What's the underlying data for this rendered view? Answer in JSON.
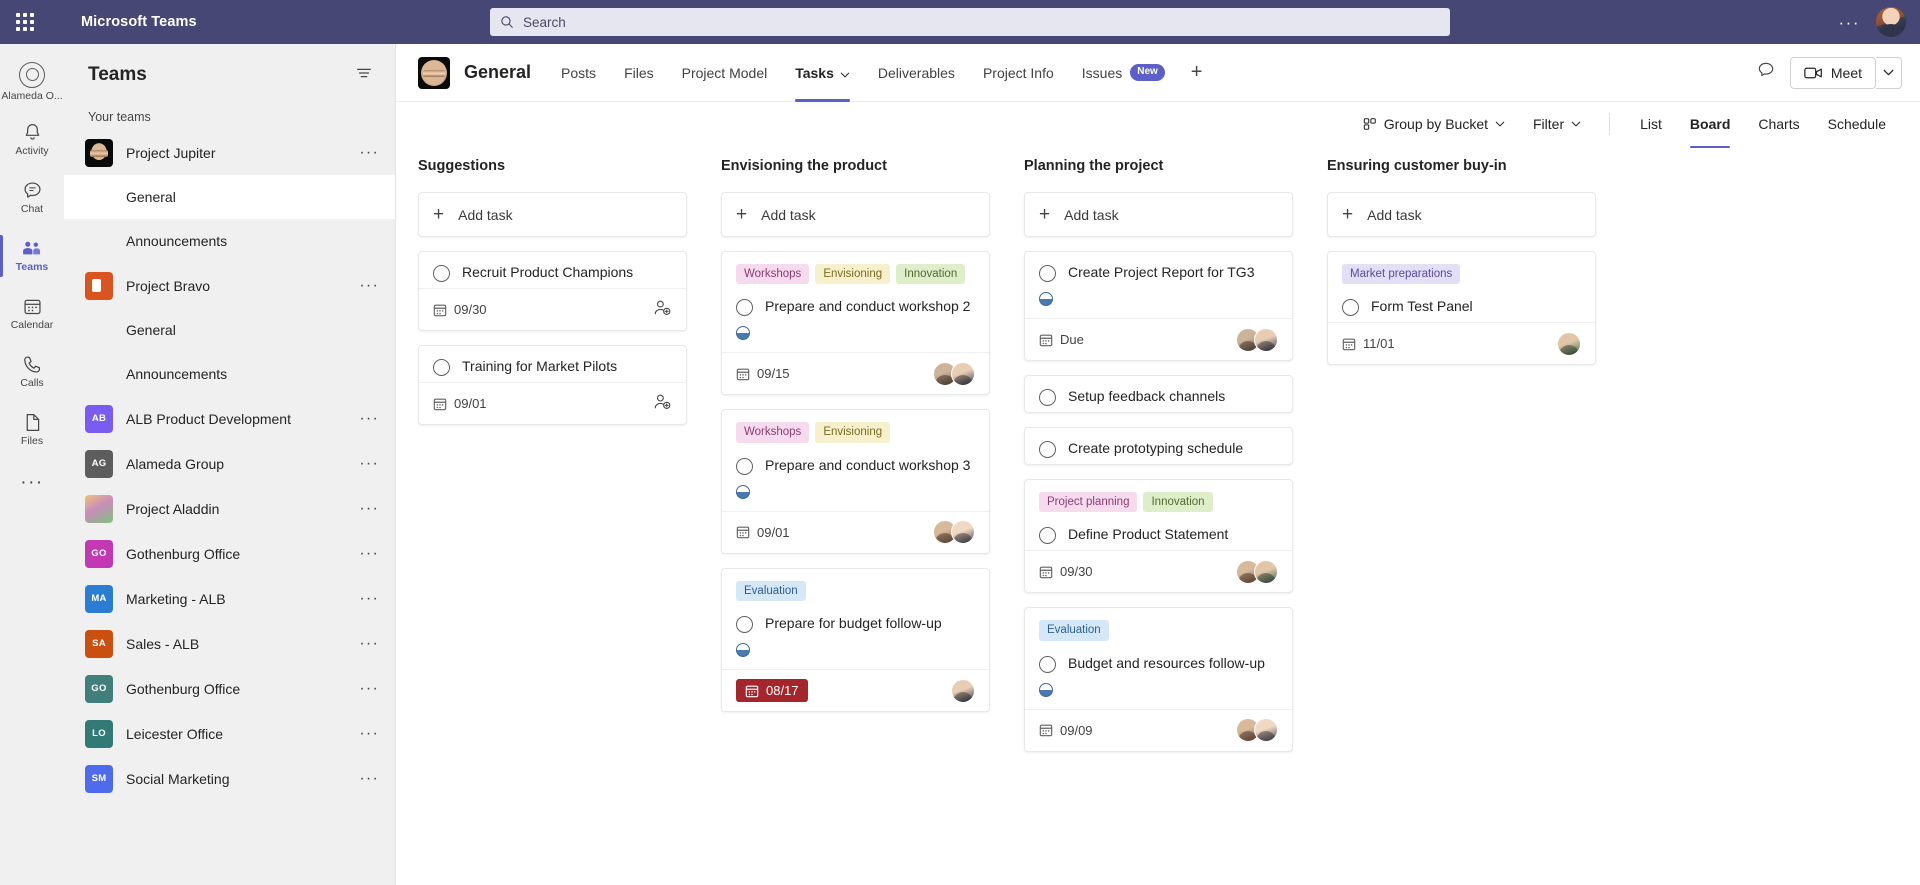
{
  "topbar": {
    "waffle_icon": "app-launcher-icon",
    "app_title": "Microsoft Teams",
    "search_placeholder": "Search",
    "search_icon": "search-icon",
    "more_label": "···",
    "avatar_name": "user-avatar",
    "bg_color": "#464775"
  },
  "rail": {
    "items": [
      {
        "label": "Alameda O...",
        "icon": "org-logo-icon",
        "active": false
      },
      {
        "label": "Activity",
        "icon": "bell-icon",
        "active": false
      },
      {
        "label": "Chat",
        "icon": "chat-bubble-icon",
        "active": false
      },
      {
        "label": "Teams",
        "icon": "teams-people-icon",
        "active": true
      },
      {
        "label": "Calendar",
        "icon": "calendar-icon",
        "active": false
      },
      {
        "label": "Calls",
        "icon": "phone-icon",
        "active": false
      },
      {
        "label": "Files",
        "icon": "file-icon",
        "active": false
      }
    ],
    "more_label": "···",
    "accent_color": "#5b5fc7"
  },
  "sidebar": {
    "title": "Teams",
    "filter_icon": "filter-list-icon",
    "section_label": "Your teams",
    "teams": [
      {
        "name": "Project Jupiter",
        "avatar_kind": "jupiter",
        "initials": "",
        "color": "#0a0a0a",
        "channels": [
          {
            "name": "General",
            "selected": true
          },
          {
            "name": "Announcements",
            "selected": false
          }
        ]
      },
      {
        "name": "Project Bravo",
        "avatar_kind": "bravo",
        "initials": "",
        "color": "#d9541e",
        "channels": [
          {
            "name": "General",
            "selected": false
          },
          {
            "name": "Announcements",
            "selected": false
          }
        ]
      },
      {
        "name": "ALB Product Development",
        "avatar_kind": "initials",
        "initials": "AB",
        "color": "#7b5cf0",
        "channels": []
      },
      {
        "name": "Alameda Group",
        "avatar_kind": "initials",
        "initials": "AG",
        "color": "#5d5d5d",
        "channels": []
      },
      {
        "name": "Project Aladdin",
        "avatar_kind": "aladdin",
        "initials": "",
        "color": "#c78dbb",
        "channels": []
      },
      {
        "name": "Gothenburg Office",
        "avatar_kind": "initials",
        "initials": "GO",
        "color": "#c239b3",
        "channels": []
      },
      {
        "name": "Marketing - ALB",
        "avatar_kind": "initials",
        "initials": "MA",
        "color": "#2b7cd3",
        "channels": []
      },
      {
        "name": "Sales - ALB",
        "avatar_kind": "initials",
        "initials": "SA",
        "color": "#ca5010",
        "channels": []
      },
      {
        "name": "Gothenburg Office",
        "avatar_kind": "initials",
        "initials": "GO",
        "color": "#407f7c",
        "channels": []
      },
      {
        "name": "Leicester Office",
        "avatar_kind": "initials",
        "initials": "LO",
        "color": "#327a76",
        "channels": []
      },
      {
        "name": "Social Marketing",
        "avatar_kind": "initials",
        "initials": "SM",
        "color": "#4f6bed",
        "channels": []
      }
    ],
    "overflow_label": "···"
  },
  "channel": {
    "avatar_name": "jupiter-channel-avatar",
    "title": "General",
    "tabs": [
      {
        "label": "Posts",
        "active": false,
        "has_caret": false,
        "badge": ""
      },
      {
        "label": "Files",
        "active": false,
        "has_caret": false,
        "badge": ""
      },
      {
        "label": "Project Model",
        "active": false,
        "has_caret": false,
        "badge": ""
      },
      {
        "label": "Tasks",
        "active": true,
        "has_caret": true,
        "badge": ""
      },
      {
        "label": "Deliverables",
        "active": false,
        "has_caret": false,
        "badge": ""
      },
      {
        "label": "Project Info",
        "active": false,
        "has_caret": false,
        "badge": ""
      },
      {
        "label": "Issues",
        "active": false,
        "has_caret": false,
        "badge": "New"
      }
    ],
    "add_tab_label": "+",
    "chat_icon": "chat-icon",
    "meet_label": "Meet",
    "meet_icon": "video-camera-icon",
    "meet_caret_icon": "chevron-down-icon"
  },
  "toolbar": {
    "group_by_label": "Group by Bucket",
    "group_by_icon": "group-icon",
    "filter_label": "Filter",
    "filter_icon": "filter-icon",
    "views": [
      {
        "label": "List",
        "active": false
      },
      {
        "label": "Board",
        "active": true
      },
      {
        "label": "Charts",
        "active": false
      },
      {
        "label": "Schedule",
        "active": false
      }
    ]
  },
  "board": {
    "add_task_label": "Add task",
    "buckets": [
      {
        "title": "Suggestions",
        "tasks": [
          {
            "labels": [],
            "title": "Recruit Product Champions",
            "progress": false,
            "date": "09/30",
            "overdue": false,
            "assign_icon": "assign-person-icon",
            "avatars": []
          },
          {
            "labels": [],
            "title": "Training for Market Pilots",
            "progress": false,
            "date": "09/01",
            "overdue": false,
            "assign_icon": "assign-person-icon",
            "avatars": []
          }
        ]
      },
      {
        "title": "Envisioning the product",
        "tasks": [
          {
            "labels": [
              {
                "text": "Workshops",
                "color": "pink"
              },
              {
                "text": "Envisioning",
                "color": "yellow"
              },
              {
                "text": "Innovation",
                "color": "green"
              }
            ],
            "title": "Prepare and conduct workshop 2",
            "progress": true,
            "date": "09/15",
            "overdue": false,
            "assign_icon": "",
            "avatars": [
              "a1",
              "a2"
            ]
          },
          {
            "labels": [
              {
                "text": "Workshops",
                "color": "pink"
              },
              {
                "text": "Envisioning",
                "color": "yellow"
              }
            ],
            "title": "Prepare and conduct workshop 3",
            "progress": true,
            "date": "09/01",
            "overdue": false,
            "assign_icon": "",
            "avatars": [
              "a3",
              "a4"
            ]
          },
          {
            "labels": [
              {
                "text": "Evaluation",
                "color": "blue"
              }
            ],
            "title": "Prepare for budget follow-up",
            "progress": true,
            "date": "08/17",
            "overdue": true,
            "assign_icon": "",
            "avatars": [
              "a2"
            ]
          }
        ]
      },
      {
        "title": "Planning the project",
        "tasks": [
          {
            "labels": [],
            "title": "Create Project Report for TG3",
            "progress": true,
            "date": "Due",
            "overdue": false,
            "assign_icon": "",
            "avatars": [
              "a1",
              "a2"
            ]
          },
          {
            "labels": [],
            "title": "Setup feedback channels",
            "progress": false,
            "date": "",
            "overdue": false,
            "assign_icon": "",
            "avatars": []
          },
          {
            "labels": [],
            "title": "Create prototyping schedule",
            "progress": false,
            "date": "",
            "overdue": false,
            "assign_icon": "",
            "avatars": []
          },
          {
            "labels": [
              {
                "text": "Project planning",
                "color": "pink"
              },
              {
                "text": "Innovation",
                "color": "green"
              }
            ],
            "title": "Define Product Statement",
            "progress": false,
            "date": "09/30",
            "overdue": false,
            "assign_icon": "",
            "avatars": [
              "a3",
              "a5"
            ]
          },
          {
            "labels": [
              {
                "text": "Evaluation",
                "color": "blue"
              }
            ],
            "title": "Budget and resources follow-up",
            "progress": true,
            "date": "09/09",
            "overdue": false,
            "assign_icon": "",
            "avatars": [
              "a3",
              "a4"
            ]
          }
        ]
      },
      {
        "title": "Ensuring customer buy-in",
        "tasks": [
          {
            "labels": [
              {
                "text": "Market preparations",
                "color": "purple"
              }
            ],
            "title": "Form Test Panel",
            "progress": false,
            "date": "11/01",
            "overdue": false,
            "assign_icon": "",
            "avatars": [
              "a5"
            ]
          }
        ]
      }
    ]
  }
}
